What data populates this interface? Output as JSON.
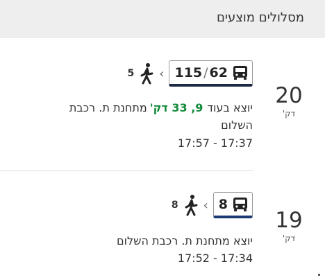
{
  "header": {
    "title": "מסלולים מוצעים"
  },
  "routes": [
    {
      "duration": "20",
      "duration_unit": "דק'",
      "walk_minutes": "5",
      "lines_a": "115",
      "lines_sep": "/",
      "lines_b": "62",
      "depart_prefix": "יוצא בעוד",
      "depart_minutes": "9, 33 דק'",
      "depart_dest": "מתחנת ת. רכבת השלום",
      "times": "17:57  -  17:37",
      "accent_color": "#1e2a44"
    },
    {
      "duration": "19",
      "duration_unit": "דק'",
      "walk_minutes": "8",
      "lines_a": "8",
      "depart_text": "יוצא מתחנת ת. רכבת השלום",
      "times": "17:52  -  17:34",
      "accent_color": "#1b3a74"
    }
  ],
  "icons": {
    "walk": "walk-icon",
    "bus": "bus-icon",
    "chevron": "chevron-left-icon"
  },
  "colors": {
    "minutes_highlight": "#128a3a",
    "header_bg": "#eeeeee"
  }
}
